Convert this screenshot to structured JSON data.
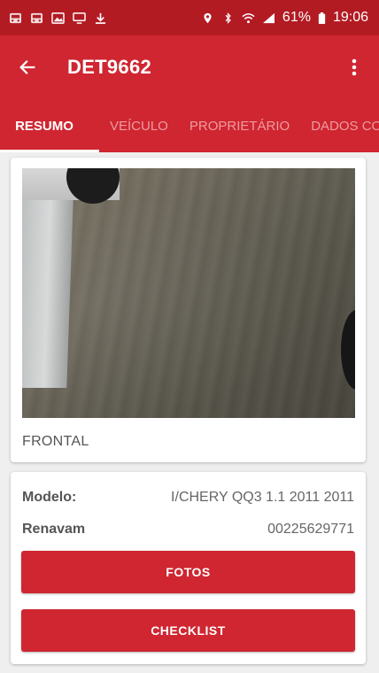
{
  "status_bar": {
    "battery": "61%",
    "time": "19:06",
    "left_icons": [
      "car-icon",
      "car-icon",
      "image-icon",
      "screen-icon",
      "download-icon"
    ],
    "right_icons": [
      "location-icon",
      "bluetooth-icon",
      "wifi-icon",
      "signal-icon",
      "battery-icon"
    ],
    "color": "#b31b23"
  },
  "app_bar": {
    "title": "DET9662",
    "back_icon": "arrow-left-icon",
    "menu_icon": "more-vert-icon",
    "color": "#cf2631"
  },
  "tabs": [
    {
      "label": "RESUMO",
      "active": true
    },
    {
      "label": "VEÍCULO",
      "active": false
    },
    {
      "label": "PROPRIETÁRIO",
      "active": false
    },
    {
      "label": "DADOS CO",
      "active": false
    }
  ],
  "photo_card": {
    "caption": "FRONTAL"
  },
  "info_card": {
    "model_label": "Modelo:",
    "model_value": "I/CHERY QQ3 1.1 2011 2011",
    "renavam_label": "Renavam",
    "renavam_value": "00225629771",
    "photos_button": "FOTOS",
    "checklist_button": "CHECKLIST"
  }
}
